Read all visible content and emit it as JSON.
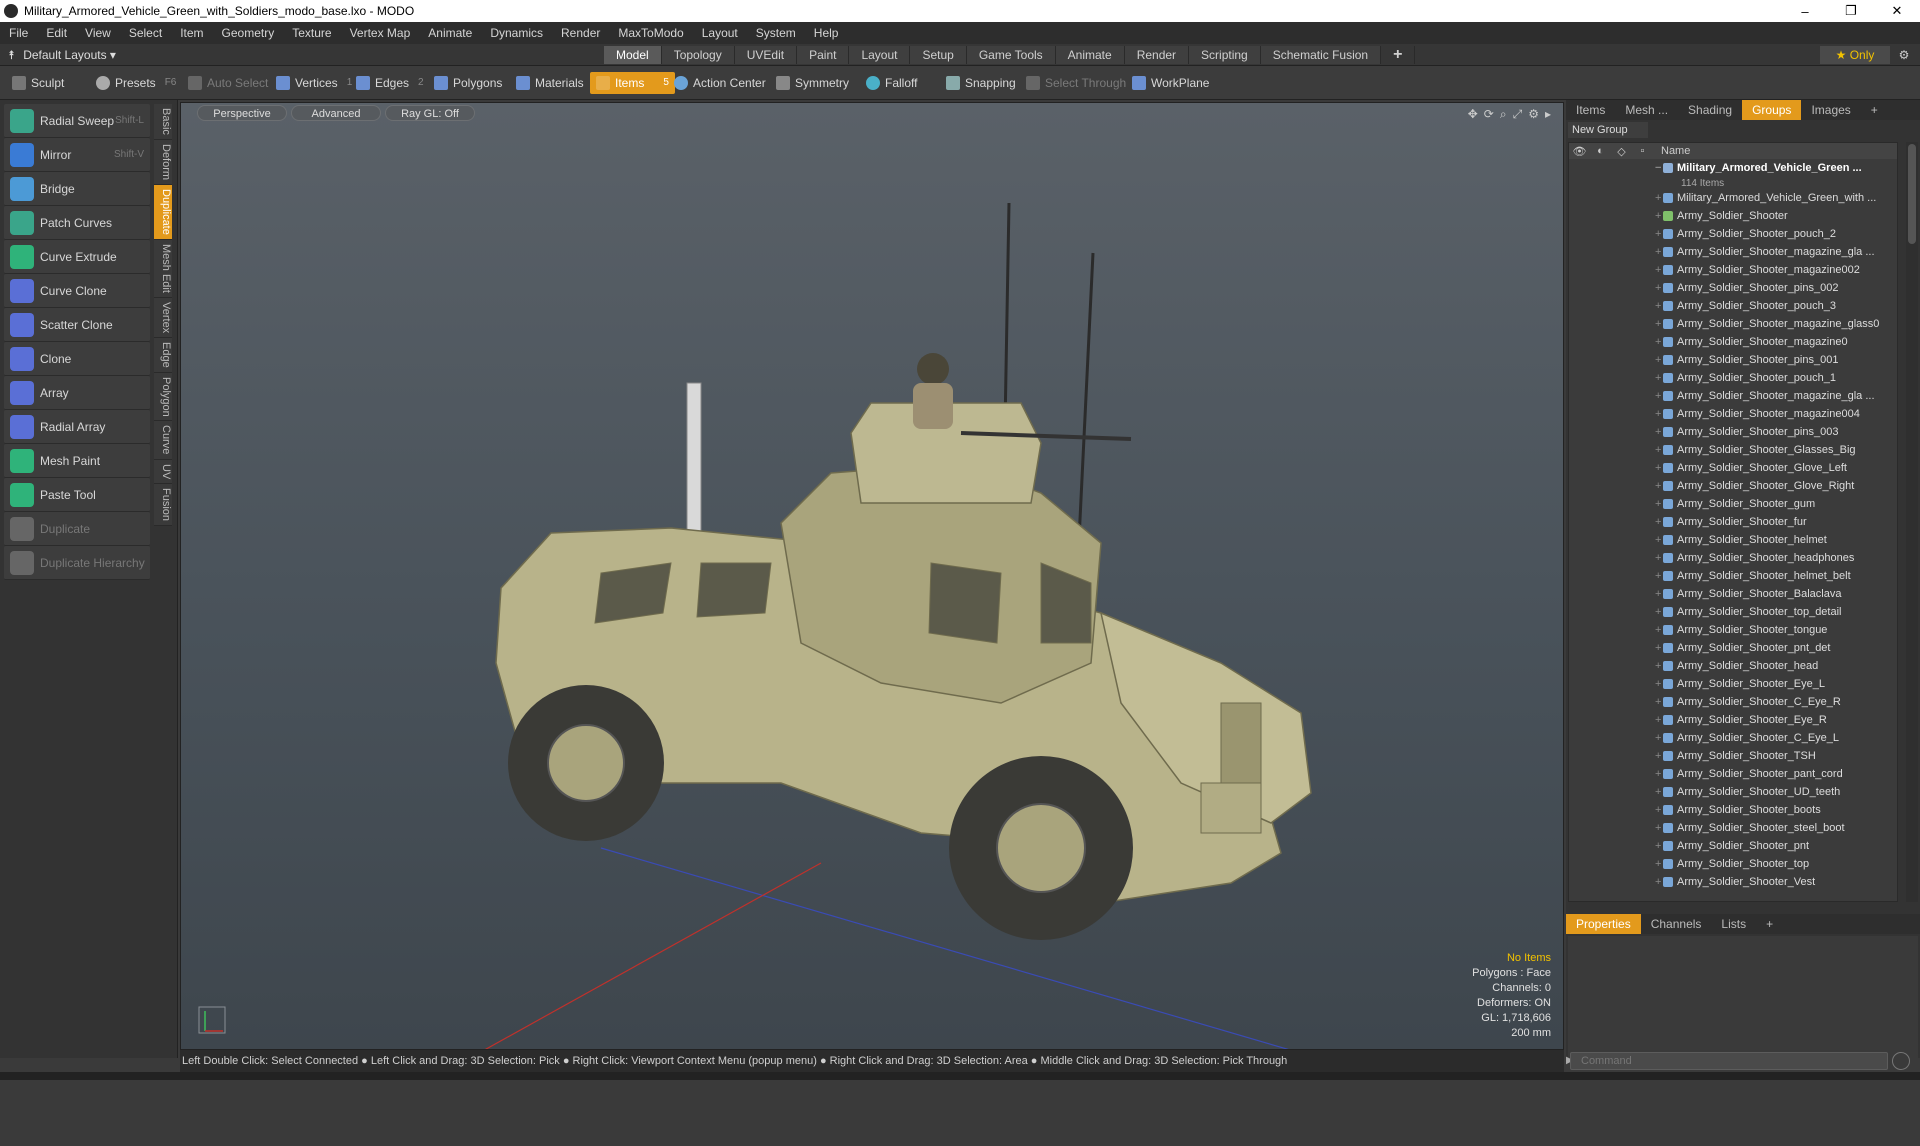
{
  "window": {
    "title": "Military_Armored_Vehicle_Green_with_Soldiers_modo_base.lxo - MODO",
    "controls": [
      "–",
      "❐",
      "✕"
    ]
  },
  "menu": [
    "File",
    "Edit",
    "View",
    "Select",
    "Item",
    "Geometry",
    "Texture",
    "Vertex Map",
    "Animate",
    "Dynamics",
    "Render",
    "MaxToModo",
    "Layout",
    "System",
    "Help"
  ],
  "layoutbar": {
    "layouts_label": "Default Layouts ▾",
    "tabs": [
      "Model",
      "Topology",
      "UVEdit",
      "Paint",
      "Layout",
      "Setup",
      "Game Tools",
      "Animate",
      "Render",
      "Scripting",
      "Schematic Fusion"
    ],
    "active_tab": "Model",
    "plus": "+",
    "only_label": "★ Only"
  },
  "toolbar": {
    "sculpt": "Sculpt",
    "presets": "Presets",
    "presets_key": "F6",
    "auto_select": "Auto Select",
    "vertices": "Vertices",
    "vertices_n": "1",
    "edges": "Edges",
    "edges_n": "2",
    "polygons": "Polygons",
    "materials": "Materials",
    "items": "Items",
    "items_n": "5",
    "action_center": "Action Center",
    "symmetry": "Symmetry",
    "falloff": "Falloff",
    "snapping": "Snapping",
    "select_through": "Select Through",
    "workplane": "WorkPlane"
  },
  "tools": [
    {
      "label": "Radial Sweep",
      "shortcut": "Shift-L",
      "color": "#3aa58a"
    },
    {
      "label": "Mirror",
      "shortcut": "Shift-V",
      "color": "#3a7bd5"
    },
    {
      "label": "Bridge",
      "shortcut": "",
      "color": "#4c9ad6"
    },
    {
      "label": "Patch Curves",
      "shortcut": "",
      "color": "#3aa58a"
    },
    {
      "label": "Curve Extrude",
      "shortcut": "",
      "color": "#2fb37a"
    },
    {
      "label": "Curve Clone",
      "shortcut": "",
      "color": "#5a6fd6"
    },
    {
      "label": "Scatter Clone",
      "shortcut": "",
      "color": "#5a6fd6"
    },
    {
      "label": "Clone",
      "shortcut": "",
      "color": "#5a6fd6"
    },
    {
      "label": "Array",
      "shortcut": "",
      "color": "#5a6fd6"
    },
    {
      "label": "Radial Array",
      "shortcut": "",
      "color": "#5a6fd6"
    },
    {
      "label": "Mesh Paint",
      "shortcut": "",
      "color": "#2fb37a"
    },
    {
      "label": "Paste Tool",
      "shortcut": "",
      "color": "#2fb37a"
    },
    {
      "label": "Duplicate",
      "shortcut": "",
      "color": "#666666"
    },
    {
      "label": "Duplicate Hierarchy",
      "shortcut": "",
      "color": "#666666"
    }
  ],
  "vtabs": [
    "Basic",
    "Deform",
    "Duplicate",
    "Mesh Edit",
    "Vertex",
    "Edge",
    "Polygon",
    "Curve",
    "UV",
    "Fusion"
  ],
  "vtab_active": "Duplicate",
  "viewport": {
    "tabs": [
      "Perspective",
      "Advanced",
      "Ray GL: Off"
    ],
    "info": {
      "selection": "No Items",
      "polygons": "Polygons : Face",
      "channels": "Channels: 0",
      "deformers": "Deformers: ON",
      "gl": "GL: 1,718,606",
      "scale": "200 mm"
    }
  },
  "rightpanel": {
    "tabs": [
      "Items",
      "Mesh ...",
      "Shading",
      "Groups",
      "Images",
      "+"
    ],
    "active_tab": "Groups",
    "new_group": "New Group",
    "name_header": "Name",
    "root": "Military_Armored_Vehicle_Green ...",
    "root_count": "114 Items",
    "items": [
      "Military_Armored_Vehicle_Green_with ...",
      "Army_Soldier_Shooter",
      "Army_Soldier_Shooter_pouch_2",
      "Army_Soldier_Shooter_magazine_gla ...",
      "Army_Soldier_Shooter_magazine002",
      "Army_Soldier_Shooter_pins_002",
      "Army_Soldier_Shooter_pouch_3",
      "Army_Soldier_Shooter_magazine_glass0",
      "Army_Soldier_Shooter_magazine0",
      "Army_Soldier_Shooter_pins_001",
      "Army_Soldier_Shooter_pouch_1",
      "Army_Soldier_Shooter_magazine_gla ...",
      "Army_Soldier_Shooter_magazine004",
      "Army_Soldier_Shooter_pins_003",
      "Army_Soldier_Shooter_Glasses_Big",
      "Army_Soldier_Shooter_Glove_Left",
      "Army_Soldier_Shooter_Glove_Right",
      "Army_Soldier_Shooter_gum",
      "Army_Soldier_Shooter_fur",
      "Army_Soldier_Shooter_helmet",
      "Army_Soldier_Shooter_headphones",
      "Army_Soldier_Shooter_helmet_belt",
      "Army_Soldier_Shooter_Balaclava",
      "Army_Soldier_Shooter_top_detail",
      "Army_Soldier_Shooter_tongue",
      "Army_Soldier_Shooter_pnt_det",
      "Army_Soldier_Shooter_head",
      "Army_Soldier_Shooter_Eye_L",
      "Army_Soldier_Shooter_C_Eye_R",
      "Army_Soldier_Shooter_Eye_R",
      "Army_Soldier_Shooter_C_Eye_L",
      "Army_Soldier_Shooter_TSH",
      "Army_Soldier_Shooter_pant_cord",
      "Army_Soldier_Shooter_UD_teeth",
      "Army_Soldier_Shooter_boots",
      "Army_Soldier_Shooter_steel_boot",
      "Army_Soldier_Shooter_pnt",
      "Army_Soldier_Shooter_top",
      "Army_Soldier_Shooter_Vest"
    ],
    "bottom_tabs": [
      "Properties",
      "Channels",
      "Lists",
      "+"
    ],
    "bottom_active": "Properties"
  },
  "statusbar": "Left Double Click: Select Connected ● Left Click and Drag: 3D Selection: Pick ● Right Click: Viewport Context Menu (popup menu) ● Right Click and Drag: 3D Selection: Area ● Middle Click and Drag: 3D Selection: Pick Through",
  "command_placeholder": "Command",
  "colors": {
    "accent": "#e39a1c",
    "highlight": "#f2c200",
    "vehicle": "#b8b38a"
  }
}
